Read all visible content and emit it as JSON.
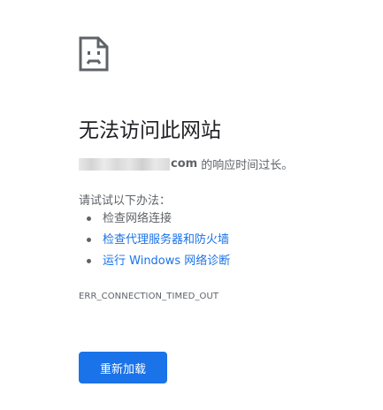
{
  "page": {
    "icon": "sad-page-icon",
    "title": "无法访问此网站",
    "summary": {
      "domain_visible_suffix": "com",
      "message": "的响应时间过长。"
    },
    "suggestions_heading": "请试试以下办法：",
    "suggestions": [
      {
        "label": "检查网络连接",
        "is_link": false
      },
      {
        "label": "检查代理服务器和防火墙",
        "is_link": true
      },
      {
        "label": "运行 Windows 网络诊断",
        "is_link": true
      }
    ],
    "error_code": "ERR_CONNECTION_TIMED_OUT",
    "reload_label": "重新加载"
  },
  "colors": {
    "accent": "#1a73e8",
    "title": "#202124",
    "secondary_text": "#5f6368",
    "background": "#ffffff"
  }
}
